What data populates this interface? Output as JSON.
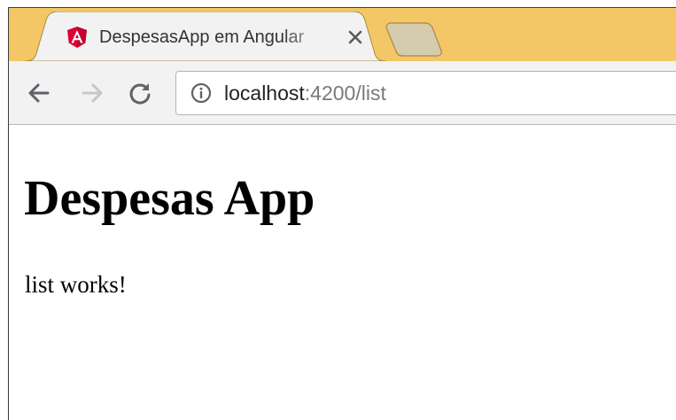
{
  "browser": {
    "tab": {
      "title": "DespesasApp em Angular",
      "favicon": "angular-logo-icon",
      "close_icon": "close-icon"
    },
    "new_tab_icon": "new-tab-icon",
    "toolbar": {
      "back_icon": "arrow-left-icon",
      "forward_icon": "arrow-right-icon",
      "reload_icon": "reload-icon",
      "info_icon": "info-icon"
    },
    "address": {
      "host": "localhost",
      "path": ":4200/list"
    }
  },
  "page": {
    "heading": "Despesas App",
    "message": "list works!"
  },
  "colors": {
    "tabstrip": "#f3c766",
    "active_tab": "#f2f2f2",
    "inactive_tab": "#d5cbae",
    "angular_red": "#dd0031",
    "angular_dark_red": "#c3002f"
  }
}
